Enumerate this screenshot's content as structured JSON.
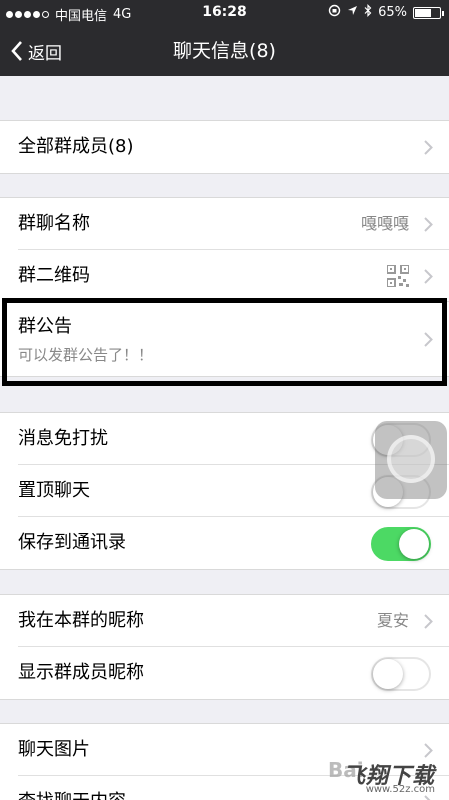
{
  "status_bar": {
    "carrier": "中国电信",
    "network": "4G",
    "time": "16:28",
    "battery": "65%",
    "battery_level": 0.65
  },
  "nav": {
    "back_label": "返回",
    "title": "聊天信息(8)"
  },
  "groups": {
    "members": {
      "label": "全部群成员(8)"
    },
    "info": {
      "name_label": "群聊名称",
      "name_value": "嘎嘎嘎",
      "qr_label": "群二维码",
      "notice_label": "群公告",
      "notice_sub": "可以发群公告了！！"
    },
    "settings": {
      "mute_label": "消息免打扰",
      "mute_on": false,
      "pin_label": "置顶聊天",
      "pin_on": false,
      "save_label": "保存到通讯录",
      "save_on": true
    },
    "nickname": {
      "my_nick_label": "我在本群的昵称",
      "my_nick_value": "夏安",
      "show_nick_label": "显示群成员昵称",
      "show_nick_on": false
    },
    "media": {
      "photos_label": "聊天图片",
      "search_label": "查找聊天内容"
    }
  },
  "watermark": {
    "brand": "飞翔下载",
    "url": "www.52z.com",
    "baidu": "Bai"
  },
  "colors": {
    "toggle_on": "#4cd964",
    "nav_bg": "#2b2b2e"
  }
}
